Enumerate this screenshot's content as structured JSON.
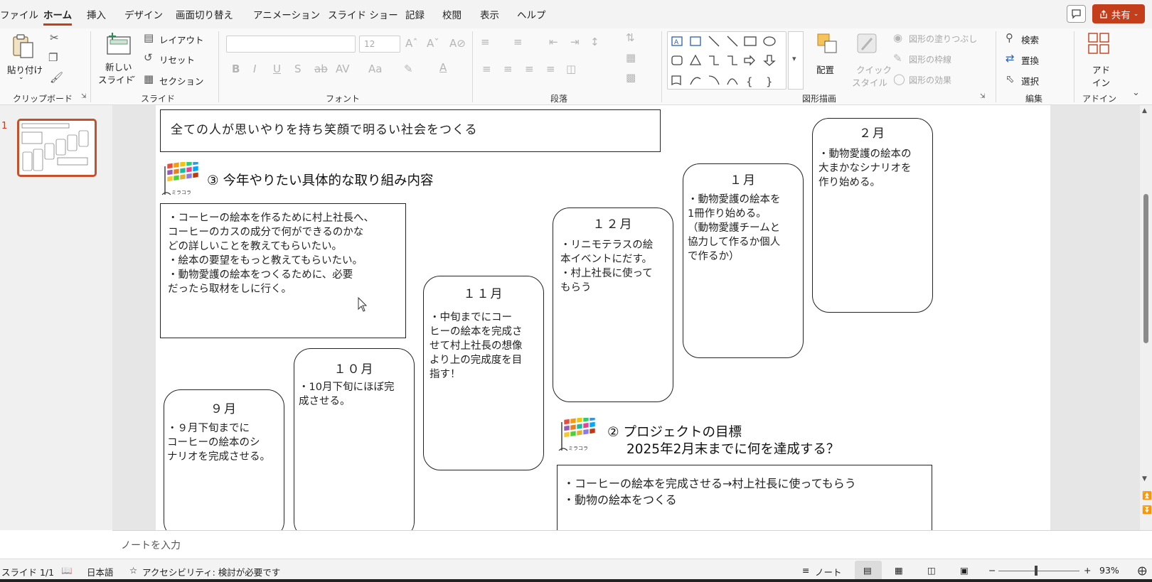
{
  "menu": {
    "tabs": [
      "ファイル",
      "ホーム",
      "挿入",
      "デザイン",
      "画面切り替え",
      "アニメーション",
      "スライド ショー",
      "記録",
      "校閲",
      "表示",
      "ヘルプ"
    ],
    "active_tab": "ホーム",
    "share_label": "共有"
  },
  "ribbon": {
    "clipboard": {
      "label": "クリップボード",
      "paste": "貼り付け"
    },
    "slides": {
      "label": "スライド",
      "new_slide_line1": "新しい",
      "new_slide_line2": "スライド",
      "layout": "レイアウト",
      "reset": "リセット",
      "section": "セクション"
    },
    "font": {
      "label": "フォント",
      "font_name": "",
      "font_size": "12"
    },
    "paragraph": {
      "label": "段落"
    },
    "drawing": {
      "label": "図形描画",
      "arrange": "配置",
      "quick_style_line1": "クイック",
      "quick_style_line2": "スタイル",
      "shape_fill": "図形の塗りつぶし",
      "shape_outline": "図形の枠線",
      "shape_effects": "図形の効果"
    },
    "editing": {
      "label": "編集",
      "find": "検索",
      "replace": "置換",
      "select": "選択"
    },
    "addins": {
      "label": "アドイン",
      "addin_line1": "アド",
      "addin_line2": "イン"
    }
  },
  "thumbnails": {
    "slide_number": "1"
  },
  "slide": {
    "top_box": "全ての人が思いやりを持ち笑顔で明るい社会をつくる",
    "section3": {
      "heading": "③ 今年やりたい具体的な取り組み内容",
      "body": "・コーヒーの絵本を作るために村上社長へ、\nコーヒーのカスの成分で何ができるのかな\nどの詳しいことを教えてもらいたい。\n・絵本の要望をもっと教えてもらいたい。\n・動物愛護の絵本をつくるために、必要\nだったら取材をしに行く。"
    },
    "months": [
      {
        "title": "９月",
        "body": "・９月下旬までに\nコーヒーの絵本のシ\nナリオを完成させる。"
      },
      {
        "title": "１０月",
        "body": "・10月下旬にほぼ完\n成させる。"
      },
      {
        "title": "１１月",
        "body": "・中旬までにコー\nヒーの絵本を完成さ\nせて村上社長の想像\nより上の完成度を目\n指す！"
      },
      {
        "title": "１２月",
        "body": "・リニモテラスの絵\n本イベントにだす。\n・村上社長に使って\nもらう"
      },
      {
        "title": "１月",
        "body": "・動物愛護の絵本を\n1冊作り始める。\n（動物愛護チームと\n協力して作るか個人\nで作るか）"
      },
      {
        "title": "２月",
        "body": "・動物愛護の絵本の\n大まかなシナリオを\n作り始める。"
      }
    ],
    "section2": {
      "heading_line1": "② プロジェクトの目標",
      "heading_line2": "2025年2月末までに何を達成する？",
      "body": "・コーヒーの絵本を完成させる→村上社長に使ってもらう\n・動物の絵本をつくる"
    },
    "logo_caption": "ミラコラ"
  },
  "notes": {
    "placeholder": "ノートを入力"
  },
  "status": {
    "slide_info": "スライド 1/1",
    "language": "日本語",
    "accessibility": "アクセシビリティ: 検討が必要です",
    "notes_btn": "ノート",
    "zoom": "93%"
  },
  "colors": {
    "accent": "#c43e1c",
    "logo": [
      "#e74c3c",
      "#f39c12",
      "#f1c40f",
      "#2ecc71",
      "#3498db",
      "#9b59b6"
    ]
  }
}
